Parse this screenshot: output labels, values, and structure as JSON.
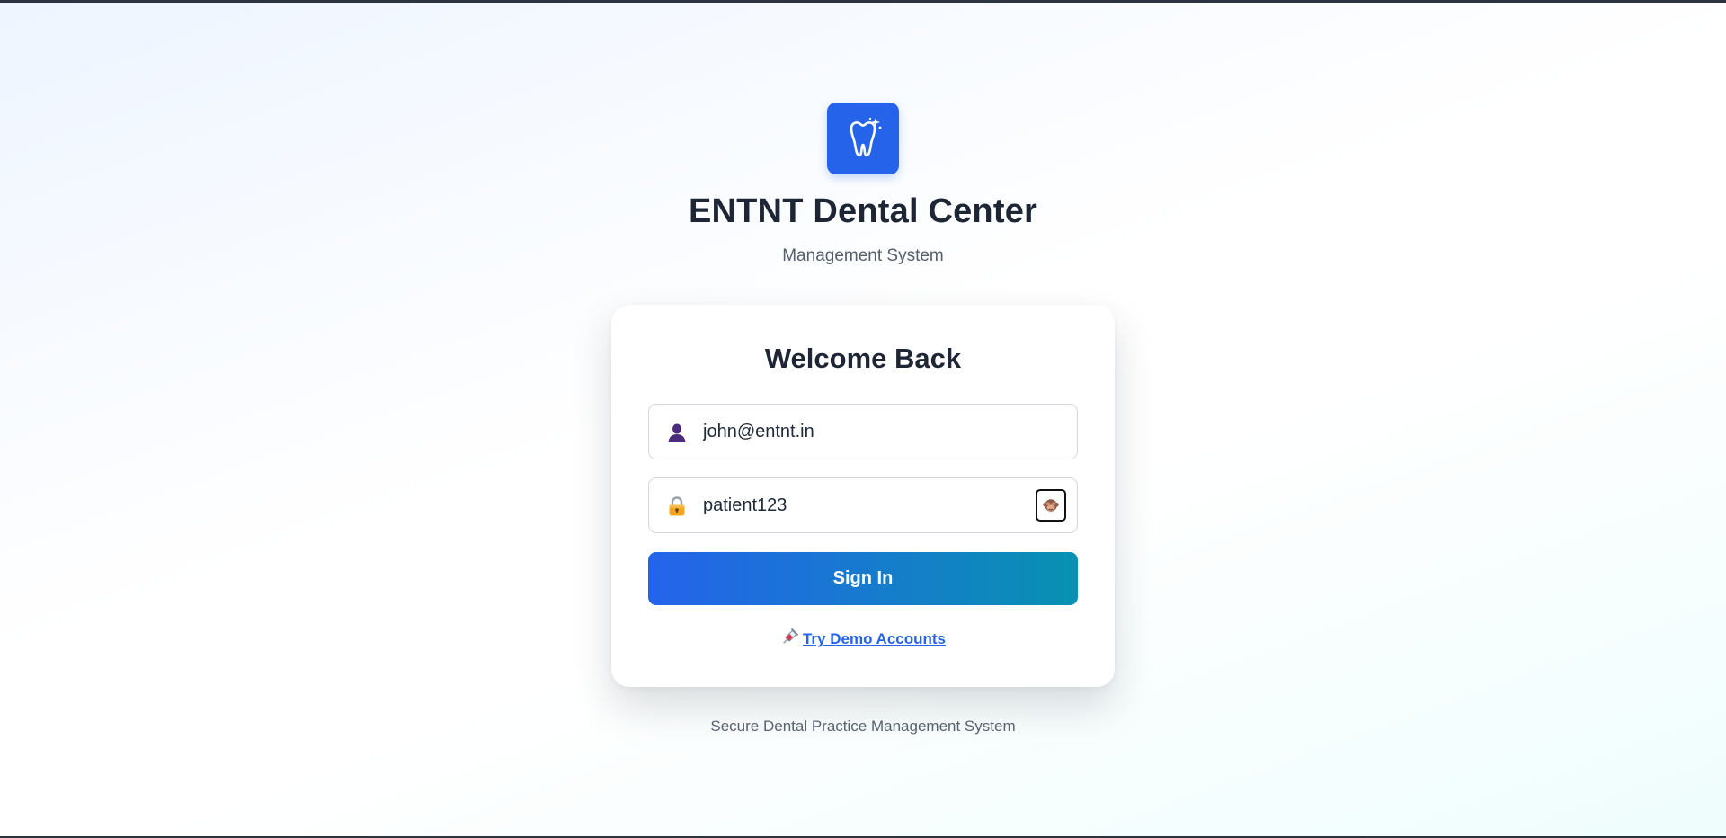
{
  "brand": {
    "title": "ENTNT Dental Center",
    "subtitle": "Management System",
    "logo_icon": "tooth-sparkle-icon",
    "accent_color": "#2563eb"
  },
  "login_card": {
    "heading": "Welcome Back",
    "email": {
      "value": "john@entnt.in",
      "icon": "user-icon"
    },
    "password": {
      "value": "patient123",
      "icon": "lock-icon",
      "toggle_icon": "see-no-evil-monkey-icon"
    },
    "submit_label": "Sign In",
    "submit_gradient": [
      "#2563eb",
      "#0891b2"
    ],
    "demo_link": {
      "label": "Try Demo Accounts",
      "icon": "syringe-icon"
    }
  },
  "footer": {
    "text": "Secure Dental Practice Management System"
  }
}
